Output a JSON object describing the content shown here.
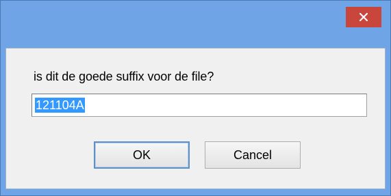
{
  "dialog": {
    "prompt": "is dit de goede suffix voor de file?",
    "input_value": "121104A",
    "ok_label": "OK",
    "cancel_label": "Cancel",
    "close_icon": "close-icon"
  },
  "colors": {
    "titlebar": "#6fa5e7",
    "close_button": "#c9463d",
    "selection": "#3399ff",
    "client_bg": "#f0f0f0"
  }
}
